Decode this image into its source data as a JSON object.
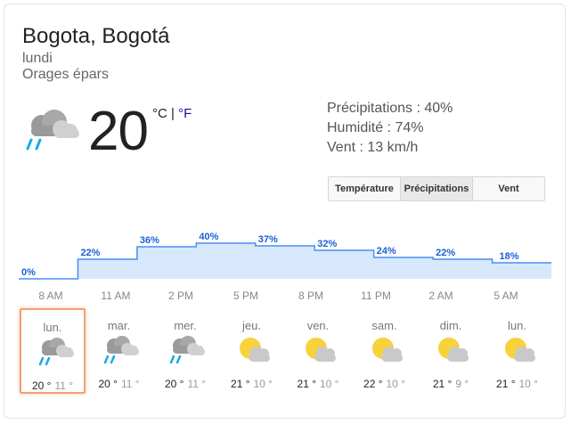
{
  "location": "Bogota, Bogotá",
  "day": "lundi",
  "condition": "Orages épars",
  "current": {
    "temperature": "20",
    "unit_c": "°C",
    "separator": "|",
    "unit_f": "°F",
    "icon": "thunderstorm-rain-icon"
  },
  "details": {
    "precip": "Précipitations : 40%",
    "humidity": "Humidité : 74%",
    "wind": "Vent : 13 km/h"
  },
  "tabs": [
    {
      "label": "Température",
      "active": false
    },
    {
      "label": "Précipitations",
      "active": true
    },
    {
      "label": "Vent",
      "active": false
    }
  ],
  "chart_data": {
    "type": "area",
    "title": "",
    "xlabel": "",
    "ylabel": "",
    "x": [
      "8 AM",
      "11 AM",
      "2 PM",
      "5 PM",
      "8 PM",
      "11 PM",
      "2 AM",
      "5 AM"
    ],
    "series": [
      {
        "values": [
          0,
          22,
          36,
          40,
          37,
          32,
          24,
          22,
          18
        ]
      }
    ],
    "value_labels": [
      "0%",
      "22%",
      "36%",
      "40%",
      "37%",
      "32%",
      "24%",
      "22%",
      "18%"
    ],
    "ylim": [
      0,
      100
    ],
    "colors": {
      "line": "#4b8ef0",
      "fill": "#d8e8fc",
      "label": "#1a5fd6"
    }
  },
  "forecast": [
    {
      "day": "lun.",
      "high": "20 °",
      "low": "11 °",
      "icon": "thunderstorm-rain-icon"
    },
    {
      "day": "mar.",
      "high": "20 °",
      "low": "11 °",
      "icon": "thunderstorm-rain-icon"
    },
    {
      "day": "mer.",
      "high": "20 °",
      "low": "11 °",
      "icon": "thunderstorm-rain-icon"
    },
    {
      "day": "jeu.",
      "high": "21 °",
      "low": "10 °",
      "icon": "partly-cloudy-icon"
    },
    {
      "day": "ven.",
      "high": "21 °",
      "low": "10 °",
      "icon": "partly-cloudy-icon"
    },
    {
      "day": "sam.",
      "high": "22 °",
      "low": "10 °",
      "icon": "partly-cloudy-icon"
    },
    {
      "day": "dim.",
      "high": "21 °",
      "low": "9 °",
      "icon": "partly-cloudy-icon"
    },
    {
      "day": "lun.",
      "high": "21 °",
      "low": "10 °",
      "icon": "partly-cloudy-icon"
    }
  ]
}
